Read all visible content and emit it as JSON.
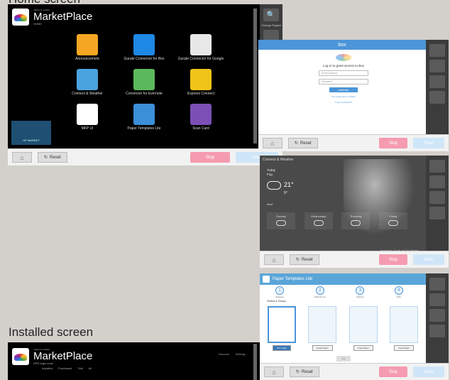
{
  "captions": {
    "home": "Home screen",
    "installed": "Installed screen"
  },
  "home": {
    "brand_pre": "market & mobility",
    "title": "MarketPlace",
    "subtitle": "HOME",
    "apps": [
      {
        "label": "Announcement",
        "color": "#f5a623",
        "icon": "announcement-icon"
      },
      {
        "label": "Gurate Connector for Box",
        "color": "#1e88e5",
        "icon": "box-connector-icon"
      },
      {
        "label": "Gurate Connector for Google",
        "color": "#e8e8e8",
        "icon": "google-connector-icon"
      },
      {
        "label": "Connect & Weather",
        "color": "#4aa3df",
        "icon": "weather-icon"
      },
      {
        "label": "Connector for Evernote",
        "color": "#5cb85c",
        "icon": "evernote-icon"
      },
      {
        "label": "Express Connect",
        "color": "#f0c419",
        "icon": "express-connect-icon"
      },
      {
        "label": "MFP UI",
        "color": "#ffffff",
        "icon": "mfp-ui-icon"
      },
      {
        "label": "Paper Templates Lite",
        "color": "#3b8fd9",
        "icon": "paper-templates-icon"
      },
      {
        "label": "Scan Card",
        "color": "#7b4fb5",
        "icon": "scan-card-icon"
      }
    ],
    "badge": "HP MARKET",
    "reset": "Reset",
    "stop": "Stop",
    "start": "Start"
  },
  "rail": {
    "zoom_label": "Change Region"
  },
  "box": {
    "title": "box",
    "login_title": "Log in to grant access to Box",
    "email_placeholder": "Email Address",
    "password_placeholder": "Password",
    "authorize": "Authorize",
    "link1": "Use single sign on (SSO)",
    "link2": "Forgot password?",
    "reset": "Reset",
    "stop": "Stop",
    "start": "Start"
  },
  "weather": {
    "title": "Connect & Weather",
    "today": "Today",
    "today_sub": "Fog",
    "temp": "21°",
    "temp_low": "9°",
    "section": "Next",
    "days": [
      "Sunday",
      "Wednesday",
      "Thursday",
      "Friday"
    ],
    "attribution": "Powered by Google and The Weather...",
    "reset": "Reset",
    "stop": "Stop",
    "start": "Start"
  },
  "paper": {
    "title": "Paper Templates Lite",
    "steps": [
      {
        "num": "1",
        "label": "Category"
      },
      {
        "num": "2",
        "label": "Preferences"
      },
      {
        "num": "3",
        "label": "Options"
      },
      {
        "num": "4",
        "label": "Print"
      }
    ],
    "heading": "Select a Group",
    "groups": [
      "Dot Graph",
      "Graph Paper",
      "Lined Paper",
      "Lined Paper"
    ],
    "page": "1/3",
    "reset": "Reset",
    "stop": "Stop",
    "start": "Start"
  },
  "installed": {
    "brand_pre": "market & mobility",
    "title": "MarketPlace",
    "subtitle": "HP® login code",
    "tabs": [
      "Installed",
      "Purchased",
      "Trial",
      "All"
    ],
    "right": [
      "Discover",
      "Settings"
    ]
  }
}
